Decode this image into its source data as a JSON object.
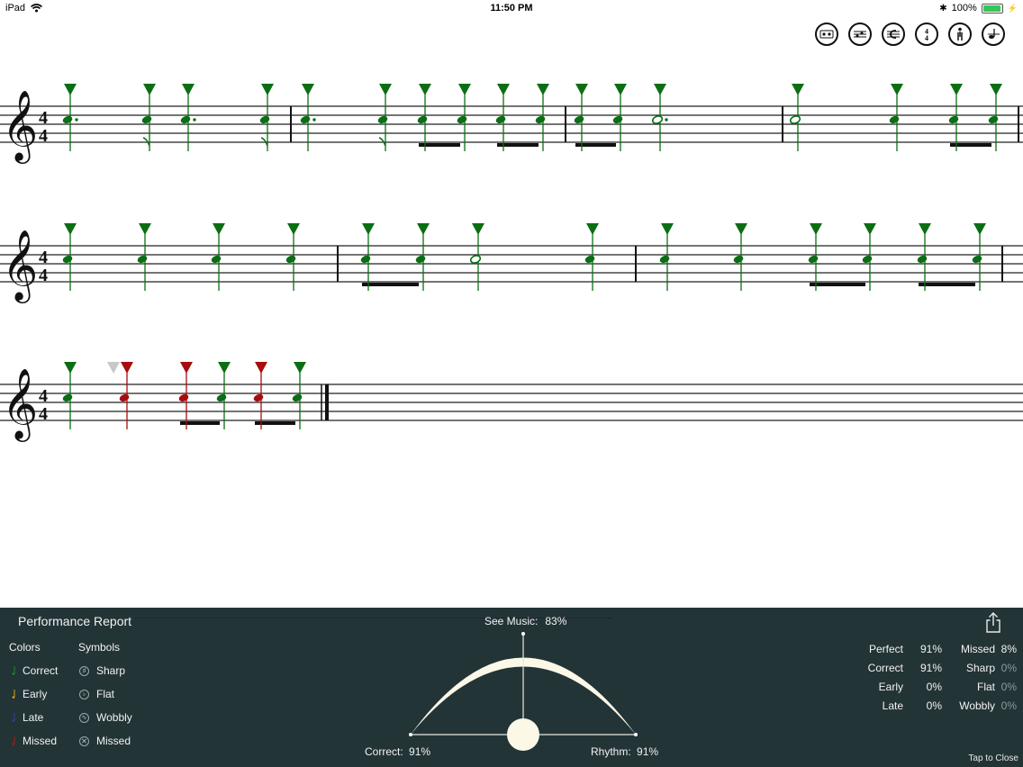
{
  "status_bar": {
    "device": "iPad",
    "time": "11:50 PM",
    "battery": "100%"
  },
  "toolbar_icons": [
    "tape-icon",
    "notes-icon",
    "clef-icon",
    "time-signature-icon",
    "metronome-player-icon",
    "tempo-icon"
  ],
  "score": {
    "time_signature": {
      "top": "4",
      "bottom": "4"
    },
    "colors": {
      "correct": "#0b6e14",
      "missed": "#a80d0d",
      "ghost": "#c8c8c8"
    }
  },
  "panel": {
    "title": "Performance Report",
    "colors_heading": "Colors",
    "symbols_heading": "Symbols",
    "colors": [
      {
        "label": "Correct",
        "color": "#1e8b2a"
      },
      {
        "label": "Early",
        "color": "#d4a800"
      },
      {
        "label": "Late",
        "color": "#2b3fb0"
      },
      {
        "label": "Missed",
        "color": "#b0151a"
      }
    ],
    "symbols": [
      {
        "label": "Sharp",
        "glyph": "♯",
        "icon": "sharp-icon"
      },
      {
        "label": "Flat",
        "glyph": "♭",
        "icon": "flat-icon"
      },
      {
        "label": "Wobbly",
        "glyph": "∿",
        "icon": "wobbly-icon"
      },
      {
        "label": "Missed",
        "glyph": "✕",
        "icon": "missed-x-icon"
      }
    ],
    "see_music_label": "See Music:",
    "see_music_value": "83%",
    "correct_label": "Correct:",
    "correct_value": "91%",
    "rhythm_label": "Rhythm:",
    "rhythm_value": "91%",
    "stats_left": [
      {
        "label": "Perfect",
        "value": "91%"
      },
      {
        "label": "Correct",
        "value": "91%"
      },
      {
        "label": "Early",
        "value": "0%"
      },
      {
        "label": "Late",
        "value": "0%"
      }
    ],
    "stats_right": [
      {
        "label": "Missed",
        "value": "8%",
        "dim": false
      },
      {
        "label": "Sharp",
        "value": "0%",
        "dim": true
      },
      {
        "label": "Flat",
        "value": "0%",
        "dim": true
      },
      {
        "label": "Wobbly",
        "value": "0%",
        "dim": true
      }
    ],
    "tap_to_close": "Tap to Close"
  }
}
